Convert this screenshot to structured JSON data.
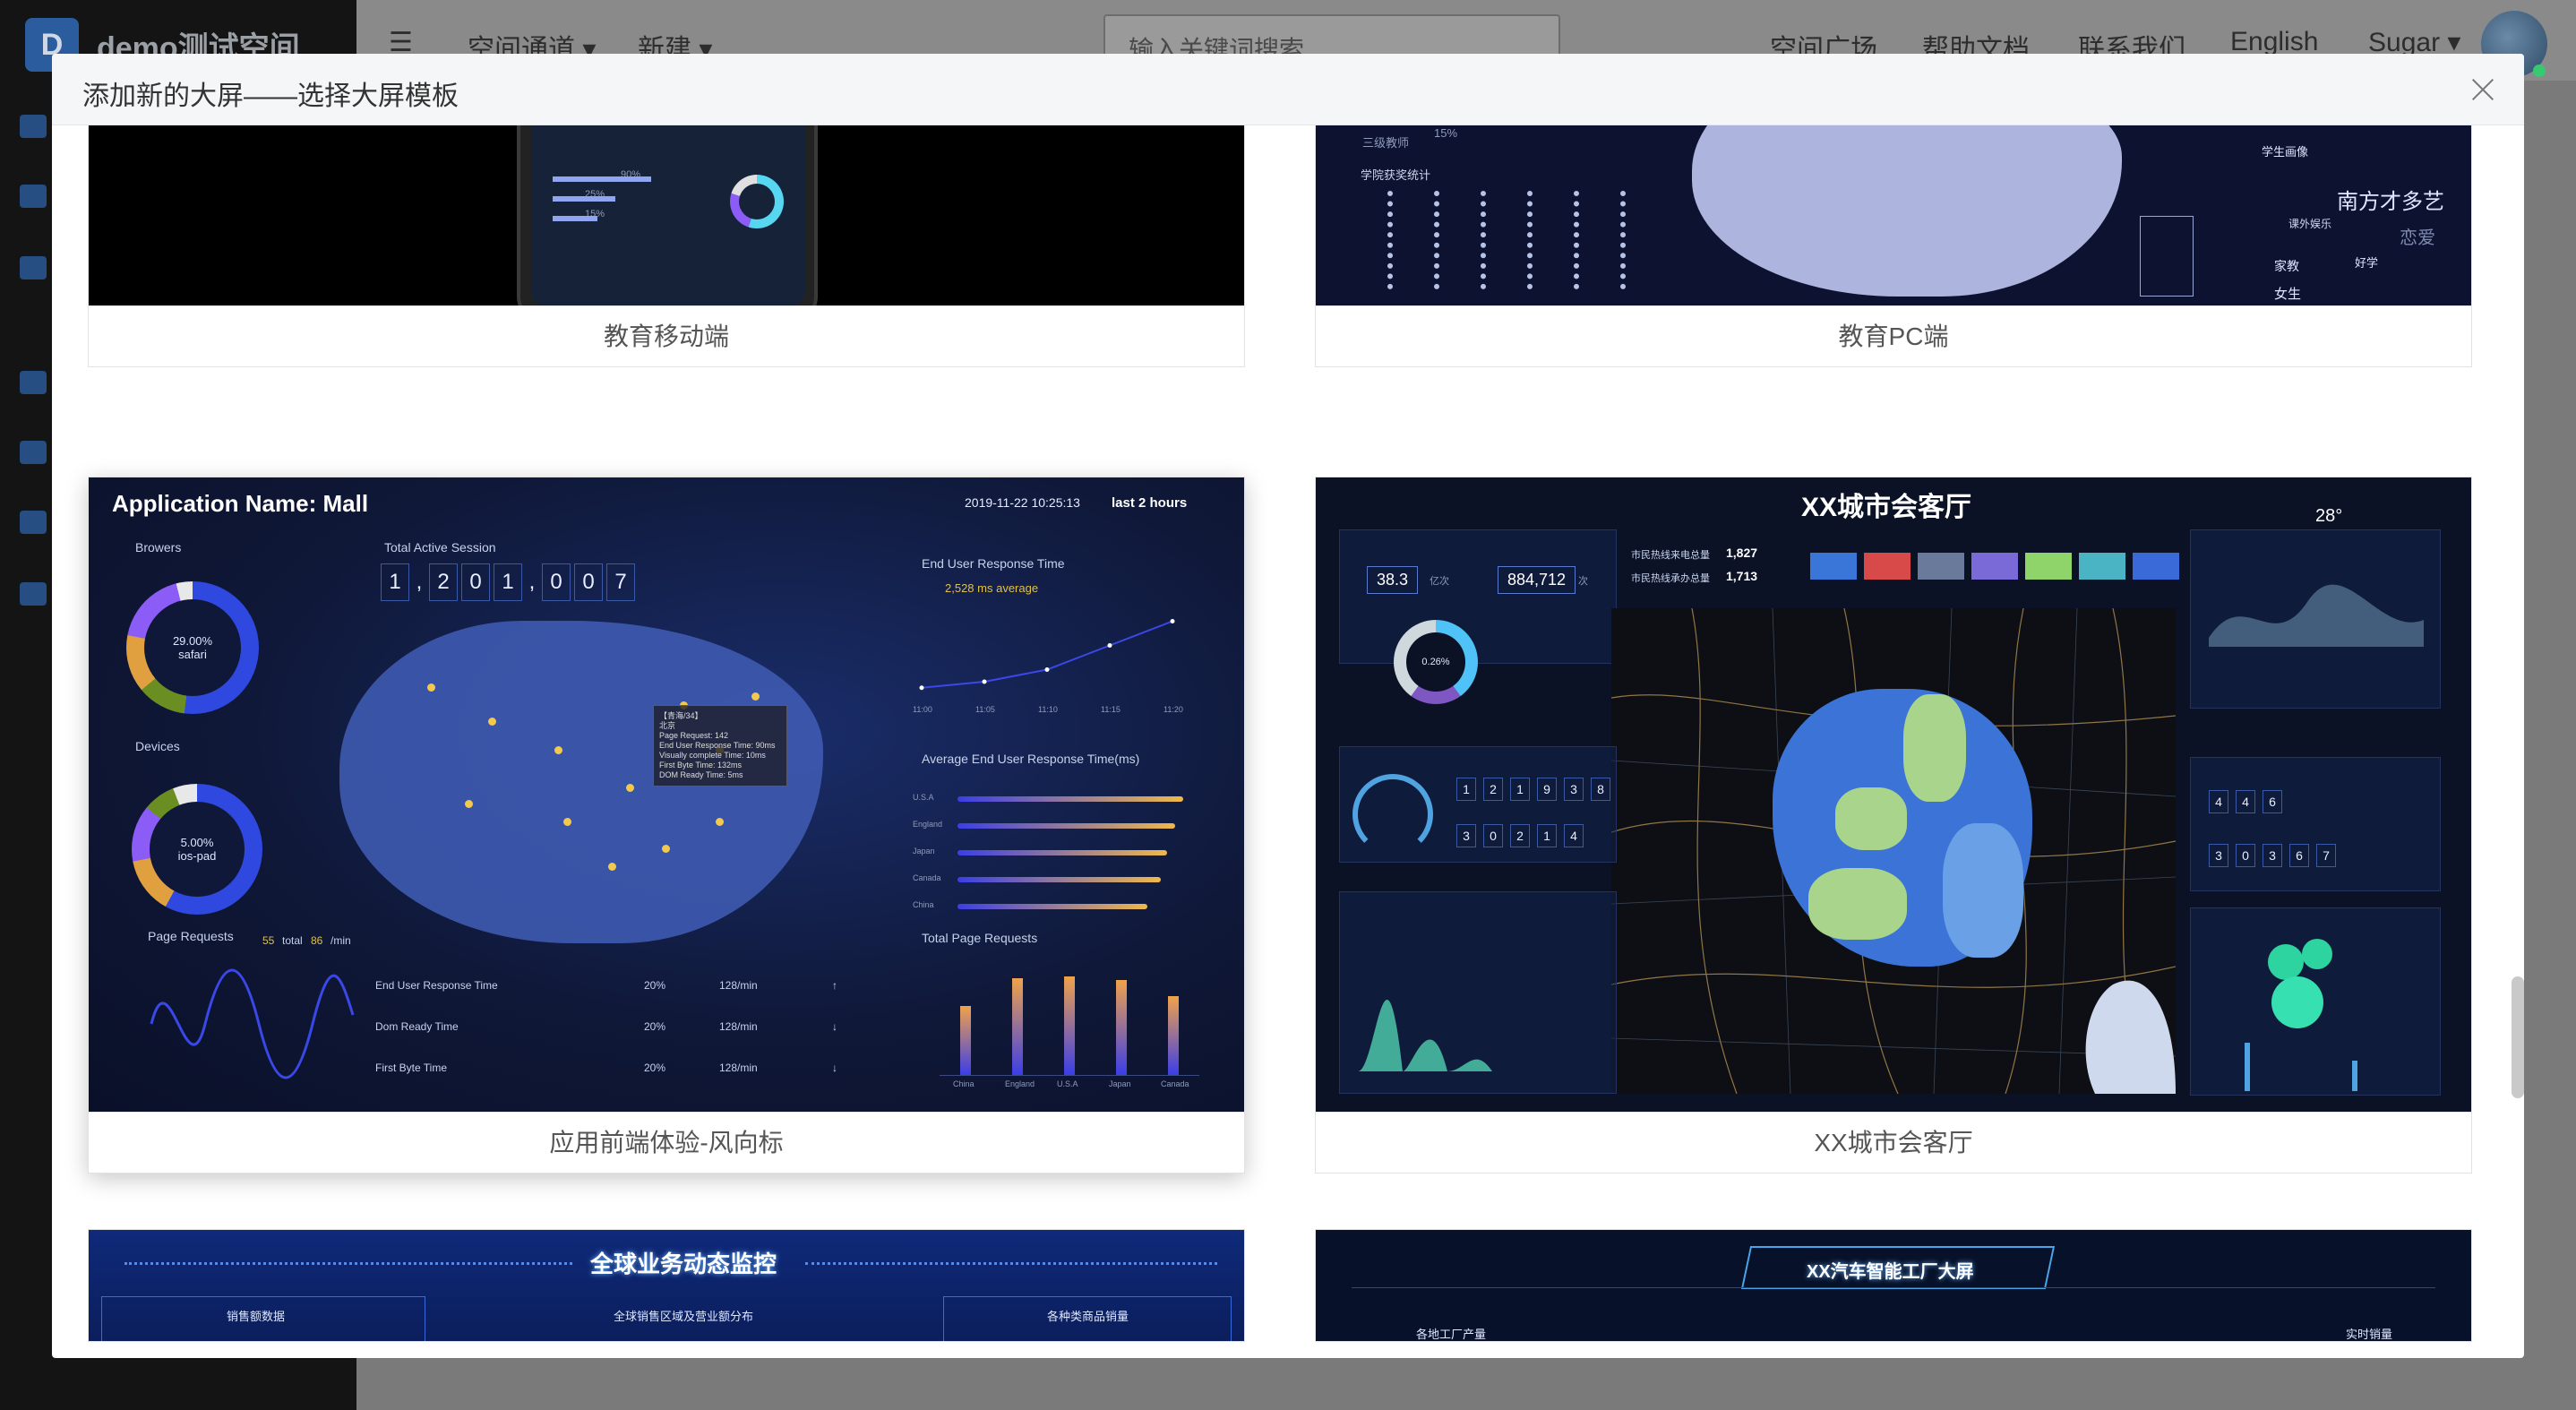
{
  "background": {
    "logo_letter": "D",
    "space_name": "demo测试空间",
    "nav": [
      "空间通道 ▾",
      "新建 ▾"
    ],
    "search_placeholder": "输入关键词搜索",
    "right_links": [
      "空间广场",
      "帮助文档",
      "联系我们",
      "English",
      "Sugar ▾"
    ]
  },
  "modal": {
    "title": "添加新的大屏——选择大屏模板",
    "close_icon": "close-icon"
  },
  "templates": [
    {
      "name": "教育移动端",
      "texts": [
        "90%",
        "25%",
        "15%"
      ]
    },
    {
      "name": "教育PC端",
      "texts": [
        "三级教师",
        "15%",
        "学院获奖统计",
        "学生画像",
        "南方才多艺",
        "课外娱乐",
        "好学",
        "家教",
        "女生",
        "恋爱"
      ]
    },
    {
      "name": "应用前端体验-风向标",
      "app_title": "Application Name: Mall",
      "datetime": "2019-11-22 10:25:13",
      "range": "last 2 hours",
      "browsers_label": "Browers",
      "browsers_center": [
        "29.00%",
        "safari"
      ],
      "devices_label": "Devices",
      "devices_center": [
        "5.00%",
        "ios-pad"
      ],
      "session_label": "Total Active Session",
      "session_digits": [
        "1",
        ",",
        "2",
        "0",
        "1",
        ",",
        "0",
        "0",
        "7"
      ],
      "end_user_response": "End User Response Time",
      "avg_ms": "2,528 ms average",
      "avg_end_user": "Average End User Response Time(ms)",
      "page_requests": "Page Requests",
      "page_requests_total": "55",
      "page_requests_total_label": "total",
      "page_requests_rate": "86",
      "page_requests_rate_label": "/min",
      "total_page_requests": "Total Page Requests",
      "table": [
        {
          "metric": "End User Response Time",
          "pct": "20%",
          "rate": "128/min",
          "arrow": "↑"
        },
        {
          "metric": "Dom Ready Time",
          "pct": "20%",
          "rate": "128/min",
          "arrow": "↓"
        },
        {
          "metric": "First Byte Time",
          "pct": "20%",
          "rate": "128/min",
          "arrow": "↓"
        }
      ],
      "tooltip": [
        "【青海/34】",
        "北京",
        "Page Request: 142",
        "End User Response Time: 90ms",
        "Visually complete Time: 10ms",
        "First Byte Time: 132ms",
        "DOM Ready Time: 5ms"
      ],
      "country_categories": [
        "China",
        "England",
        "U.S.A",
        "Japan",
        "Canada"
      ]
    },
    {
      "name": "XX城市会客厅",
      "title": "XX城市会客厅",
      "stat1": "38.3",
      "stat1_unit": "亿次",
      "stat2": "884,712",
      "stat2_unit": "次",
      "hotline1_label": "市民热线来电总量",
      "hotline1_value": "1,827",
      "hotline2_label": "市民热线承办总量",
      "hotline2_value": "1,713",
      "gauge_center": "0.26%",
      "weather_temp": "28°",
      "panel_digits_1": [
        "1",
        "2",
        "1",
        "9",
        "3",
        "8"
      ],
      "panel_digits_2": [
        "3",
        "0",
        "2",
        "1",
        "4"
      ],
      "panel_digits_3": [
        "4",
        "4",
        "6"
      ],
      "panel_digits_4": [
        "3",
        "0",
        "3",
        "6",
        "7"
      ]
    },
    {
      "name": "全球业务动态监控",
      "title": "全球业务动态监控",
      "sub": [
        "销售额数据",
        "全球销售区域及营业额分布",
        "各种类商品销量"
      ]
    },
    {
      "name": "XX汽车智能工厂大屏",
      "title": "XX汽车智能工厂大屏",
      "sub": [
        "各地工厂产量",
        "实时销量"
      ]
    }
  ],
  "chart_data": [
    {
      "type": "bar",
      "title": "Total Page Requests",
      "categories": [
        "China",
        "England",
        "U.S.A",
        "Japan",
        "Canada"
      ],
      "values": [
        4200,
        5900,
        6000,
        5800,
        4800
      ],
      "ylim": [
        0,
        7000
      ]
    },
    {
      "type": "line",
      "title": "End User Response Time",
      "subtitle": "2,528 ms average",
      "x": [
        "11:00",
        "11:05",
        "11:10",
        "11:15",
        "11:20"
      ],
      "values": [
        5,
        8,
        14,
        26,
        38
      ]
    },
    {
      "type": "bar",
      "title": "Average End User Response Time(ms)",
      "categories": [
        "U.S.A",
        "England",
        "Japan",
        "Canada",
        "China"
      ],
      "values": [
        14,
        13.5,
        13,
        12.6,
        11.8
      ],
      "xlim": [
        0,
        15
      ]
    }
  ]
}
